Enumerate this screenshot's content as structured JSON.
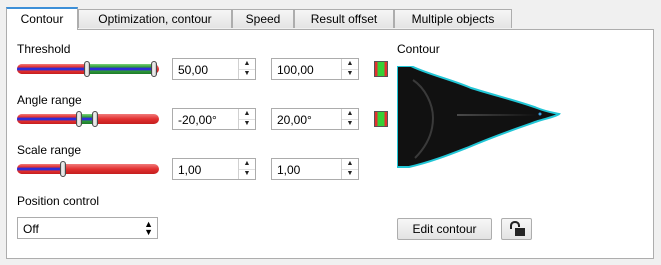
{
  "tabs": [
    "Contour",
    "Optimization, contour",
    "Speed",
    "Result offset",
    "Multiple objects"
  ],
  "threshold": {
    "label": "Threshold",
    "min": "50,00",
    "max": "100,00"
  },
  "angle_range": {
    "label": "Angle range",
    "min": "-20,00°",
    "max": "20,00°"
  },
  "scale_range": {
    "label": "Scale range",
    "min": "1,00",
    "max": "1,00"
  },
  "position_control": {
    "label": "Position control",
    "value": "Off"
  },
  "contour": {
    "label": "Contour",
    "edit_button": "Edit contour"
  },
  "icons": {
    "spin_up": "▲",
    "spin_down": "▼",
    "lock": "unlock-icon"
  },
  "colors": {
    "tab_accent": "#3c8fd8",
    "slider_red": "#e83a3a",
    "slider_green": "#2e9a3a",
    "slider_blue": "#3a3ad8",
    "contour_line": "#21c6d6"
  }
}
